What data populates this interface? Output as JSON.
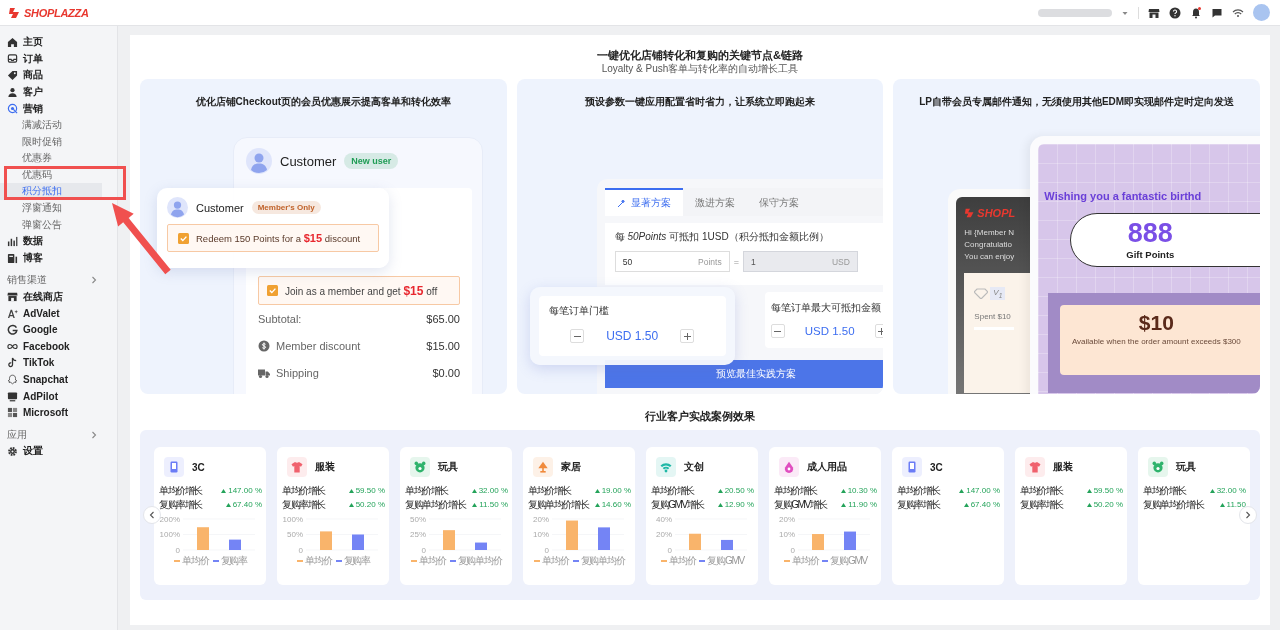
{
  "header": {
    "logo": "SHOPLAZZA",
    "notification": true
  },
  "sidebar": {
    "items": [
      {
        "kind": "nav",
        "label": "主页",
        "selected": false
      },
      {
        "kind": "nav",
        "label": "订单",
        "selected": false
      },
      {
        "kind": "nav",
        "label": "商品",
        "selected": false
      },
      {
        "kind": "nav",
        "label": "客户",
        "selected": false
      },
      {
        "kind": "nav",
        "label": "营销",
        "selected": false,
        "children": [
          {
            "label": "满减活动",
            "selected": false
          },
          {
            "label": "限时促销",
            "selected": false
          },
          {
            "label": "优惠券",
            "selected": false
          },
          {
            "label": "优惠码",
            "selected": false
          },
          {
            "label": "积分抵扣",
            "selected": true
          },
          {
            "label": "浮窗通知",
            "selected": false
          },
          {
            "label": "弹窗公告",
            "selected": false
          }
        ]
      },
      {
        "kind": "nav",
        "label": "数据",
        "selected": false
      },
      {
        "kind": "nav",
        "label": "博客",
        "selected": false
      },
      {
        "kind": "section",
        "label": "销售渠道"
      },
      {
        "kind": "nav",
        "label": "在线商店",
        "selected": false
      },
      {
        "kind": "nav",
        "label": "AdValet",
        "selected": false
      },
      {
        "kind": "nav",
        "label": "Google",
        "selected": false
      },
      {
        "kind": "nav",
        "label": "Facebook",
        "selected": false
      },
      {
        "kind": "nav",
        "label": "TikTok",
        "selected": false
      },
      {
        "kind": "nav",
        "label": "Snapchat",
        "selected": false
      },
      {
        "kind": "nav",
        "label": "AdPilot",
        "selected": false
      },
      {
        "kind": "nav",
        "label": "Microsoft",
        "selected": false
      },
      {
        "kind": "section",
        "label": "应用"
      },
      {
        "kind": "nav",
        "label": "设置",
        "selected": false
      }
    ]
  },
  "intro": {
    "title": "一键优化店铺转化和复购的关键节点&链路",
    "subtitle": "Loyalty & Push客单与转化率的自动增长工具"
  },
  "features": [
    {
      "kind": "checkout",
      "caption": "优化店铺Checkout页的会员优惠展示提高客单和转化效率",
      "back_card": {
        "customer": "Customer",
        "badge": {
          "text": "New user",
          "color": "#1f9d55"
        },
        "offer": {
          "text": "Join as a member and get **$15** off",
          "checked": true
        },
        "summary": [
          {
            "label": "Subtotal:",
            "value": "$65.00"
          },
          {
            "label": "Member discount",
            "value": "$15.00"
          },
          {
            "label": "Shipping",
            "value": "$0.00"
          }
        ]
      },
      "front_card": {
        "customer": "Customer",
        "badge": {
          "text": "Member's Only",
          "color": "#c0622a"
        },
        "offer": {
          "text": "Redeem 150 Points for a **$15** discount",
          "checked": true
        }
      }
    },
    {
      "kind": "config",
      "caption": "预设参数一键应用配置省时省力，让系统立即跑起来",
      "tabs": [
        {
          "label": "显著方案",
          "selected": true
        },
        {
          "label": "激进方案",
          "selected": false
        },
        {
          "label": "保守方案",
          "selected": false
        }
      ],
      "ratio_text": "每 *50Points* 可抵扣 1USD（积分抵扣金额比例）",
      "equals": "=",
      "fields": [
        {
          "value": "50",
          "unit": "Points",
          "disabled": false
        },
        {
          "value": "1",
          "unit": "USD",
          "disabled": true
        }
      ],
      "steppers": [
        {
          "label": "每笔订单门槛",
          "value": "USD 1.50"
        },
        {
          "label": "每笔订单最大可抵扣金额",
          "value": "USD 1.50"
        }
      ],
      "button": "预览最佳实践方案"
    },
    {
      "kind": "email",
      "caption": "LP自带会员专属邮件通知，无须使用其他EDM即实现邮件定时定向发送",
      "dark_email": {
        "logo": "SHOPL",
        "lines": [
          "Hi {Member N",
          "Congratulatio",
          "You can enjoy"
        ],
        "level_badge": "V$_{1}$",
        "spent": "Spent $10"
      },
      "birthday_email": {
        "heading": "Wishing you a fantastic birthd",
        "points": "888",
        "points_label": "Gift Points",
        "coupon_amount": "$10",
        "coupon_text": "Available when the order amount exceeds $300"
      }
    }
  ],
  "cases": {
    "title": "行业客户实战案例效果",
    "cards": [
      {
        "color": "#6b7cf6",
        "name": "3C",
        "metrics": [
          {
            "label": "单均价增长",
            "value": "147.00 %"
          },
          {
            "label": "复购率增长",
            "value": "67.40 %"
          }
        ],
        "chart_data": {
          "type": "bar",
          "categories": [
            null
          ],
          "ylim": [
            0,
            200
          ],
          "yticks": [
            {
              "value": 0,
              "label": "0"
            },
            {
              "value": 100,
              "label": "100%"
            },
            {
              "value": 200,
              "label": "200%"
            }
          ],
          "series": [
            {
              "name": "单均价",
              "color": "#f9b46b",
              "values": [
                147
              ]
            },
            {
              "name": "复购率",
              "color": "#7484f5",
              "values": [
                67
              ]
            }
          ],
          "legend": "bottom"
        }
      },
      {
        "color": "#f0616d",
        "name": "服装",
        "metrics": [
          {
            "label": "单均价增长",
            "value": "59.50 %"
          },
          {
            "label": "复购率增长",
            "value": "50.20 %"
          }
        ],
        "chart_data": {
          "type": "bar",
          "categories": [
            null
          ],
          "ylim": [
            0,
            100
          ],
          "yticks": [
            {
              "value": 0,
              "label": "0"
            },
            {
              "value": 50,
              "label": "50%"
            },
            {
              "value": 100,
              "label": "100%"
            }
          ],
          "series": [
            {
              "name": "单均价",
              "color": "#f9b46b",
              "values": [
                60
              ]
            },
            {
              "name": "复购率",
              "color": "#7484f5",
              "values": [
                50
              ]
            }
          ],
          "legend": "bottom"
        }
      },
      {
        "color": "#2fb36c",
        "name": "玩具",
        "metrics": [
          {
            "label": "单均价增长",
            "value": "32.00 %"
          },
          {
            "label": "复购单均价增长",
            "value": "11.50 %"
          }
        ],
        "chart_data": {
          "type": "bar",
          "categories": [
            null
          ],
          "ylim": [
            0,
            50
          ],
          "yticks": [
            {
              "value": 0,
              "label": "0"
            },
            {
              "value": 25,
              "label": "25%"
            },
            {
              "value": 50,
              "label": "50%"
            }
          ],
          "series": [
            {
              "name": "单均价",
              "color": "#f9b46b",
              "values": [
                32
              ]
            },
            {
              "name": "复购单均价",
              "color": "#7484f5",
              "values": [
                12
              ]
            }
          ],
          "legend": "bottom"
        }
      },
      {
        "color": "#f08a3c",
        "name": "家居",
        "metrics": [
          {
            "label": "单均价增长",
            "value": "19.00 %"
          },
          {
            "label": "复购单均价增长",
            "value": "14.60 %"
          }
        ],
        "chart_data": {
          "type": "bar",
          "categories": [
            null
          ],
          "ylim": [
            0,
            20
          ],
          "yticks": [
            {
              "value": 0,
              "label": "0"
            },
            {
              "value": 10,
              "label": "10%"
            },
            {
              "value": 20,
              "label": "20%"
            }
          ],
          "series": [
            {
              "name": "单均价",
              "color": "#f9b46b",
              "values": [
                19
              ]
            },
            {
              "name": "复购单均价",
              "color": "#7484f5",
              "values": [
                14.6
              ]
            }
          ],
          "legend": "bottom"
        }
      },
      {
        "color": "#1fb8a6",
        "name": "文创",
        "metrics": [
          {
            "label": "单均价增长",
            "value": "20.50 %"
          },
          {
            "label": "复购GMV增长",
            "value": "12.90 %"
          }
        ],
        "chart_data": {
          "type": "bar",
          "categories": [
            null
          ],
          "ylim": [
            0,
            40
          ],
          "yticks": [
            {
              "value": 0,
              "label": "0"
            },
            {
              "value": 20,
              "label": "20%"
            },
            {
              "value": 40,
              "label": "40%"
            }
          ],
          "series": [
            {
              "name": "单均价",
              "color": "#f9b46b",
              "values": [
                21
              ]
            },
            {
              "name": "复购GMV",
              "color": "#7484f5",
              "values": [
                13
              ]
            }
          ],
          "legend": "bottom"
        }
      },
      {
        "color": "#e04fc0",
        "name": "成人用品",
        "metrics": [
          {
            "label": "单均价增长",
            "value": "10.30 %"
          },
          {
            "label": "复购GMV增长",
            "value": "11.90 %"
          }
        ],
        "chart_data": {
          "type": "bar",
          "categories": [
            null
          ],
          "ylim": [
            0,
            20
          ],
          "yticks": [
            {
              "value": 0,
              "label": "0"
            },
            {
              "value": 10,
              "label": "10%"
            },
            {
              "value": 20,
              "label": "20%"
            }
          ],
          "series": [
            {
              "name": "单均价",
              "color": "#f9b46b",
              "values": [
                10.3
              ]
            },
            {
              "name": "复购GMV",
              "color": "#7484f5",
              "values": [
                11.9
              ]
            }
          ],
          "legend": "bottom"
        }
      },
      {
        "color": "#6b7cf6",
        "name": "3C",
        "metrics": [
          {
            "label": "单均价增长",
            "value": "147.00 %"
          },
          {
            "label": "复购率增长",
            "value": "67.40 %"
          }
        ]
      },
      {
        "color": "#f0616d",
        "name": "服装",
        "metrics": [
          {
            "label": "单均价增长",
            "value": "59.50 %"
          },
          {
            "label": "复购率增长",
            "value": "50.20 %"
          }
        ]
      },
      {
        "color": "#2fb36c",
        "name": "玩具",
        "metrics": [
          {
            "label": "单均价增长",
            "value": "32.00 %"
          },
          {
            "label": "复购单均价增长",
            "value": "11.50"
          }
        ]
      }
    ]
  }
}
